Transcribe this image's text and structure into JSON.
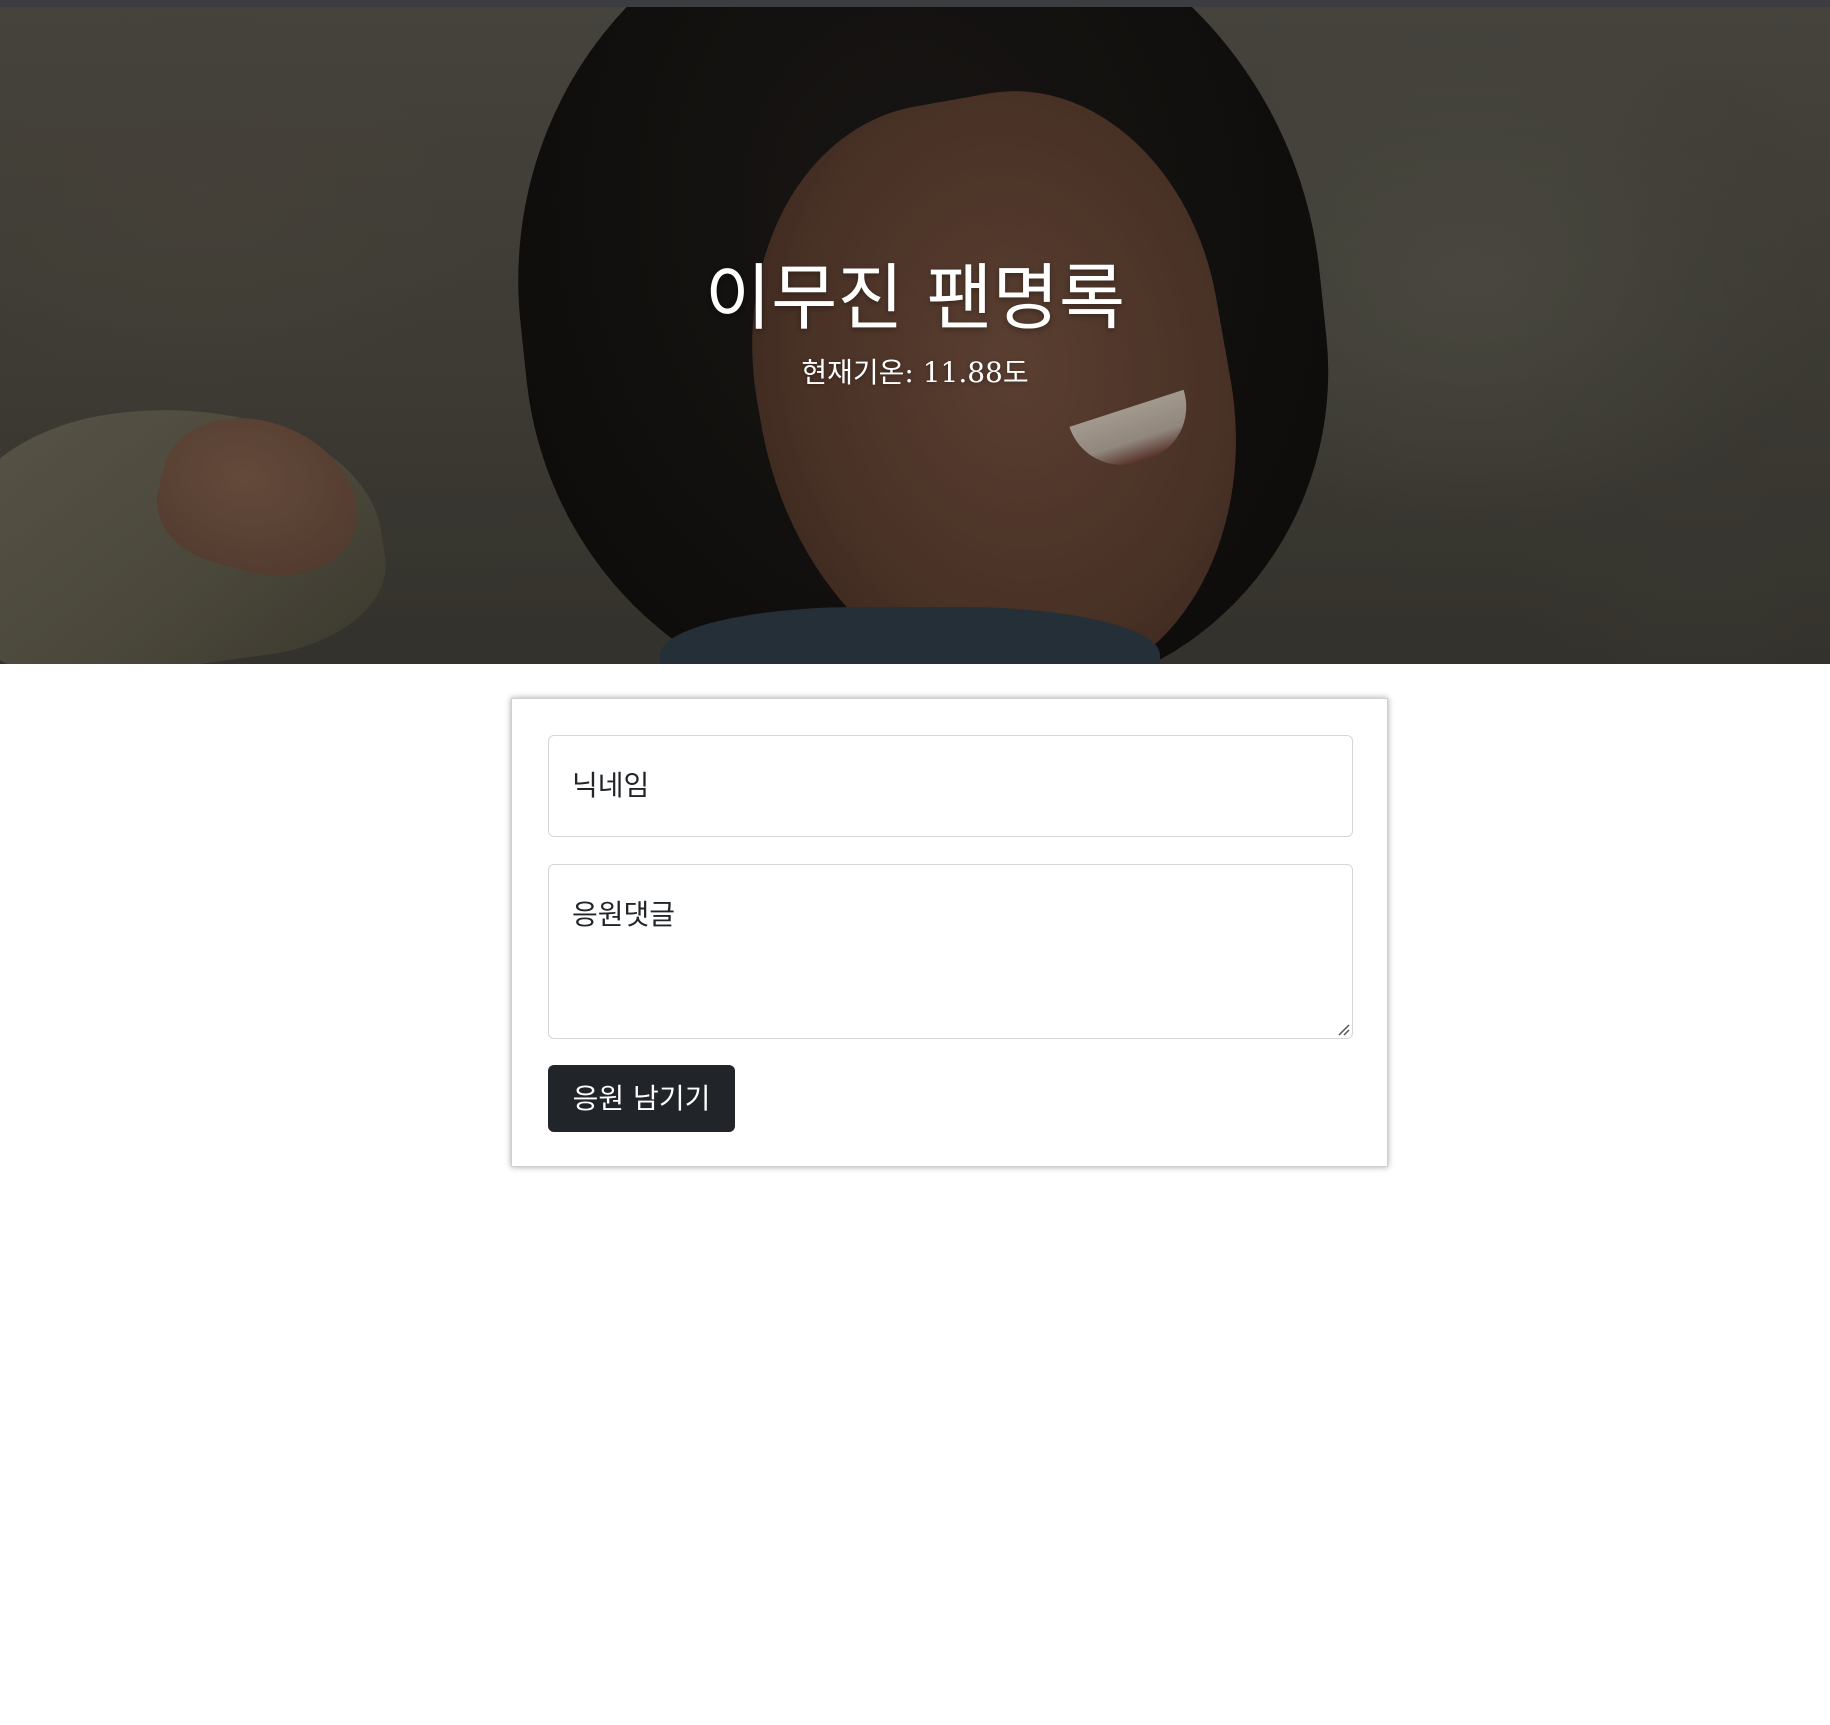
{
  "hero": {
    "title": "이무진 팬명록",
    "temperature_text": "현재기온: 11.88도",
    "overlay_color": "#000000"
  },
  "form": {
    "nickname_placeholder": "닉네임",
    "comment_placeholder": "응원댓글",
    "submit_label": "응원 남기기",
    "button_color": "#212529"
  }
}
